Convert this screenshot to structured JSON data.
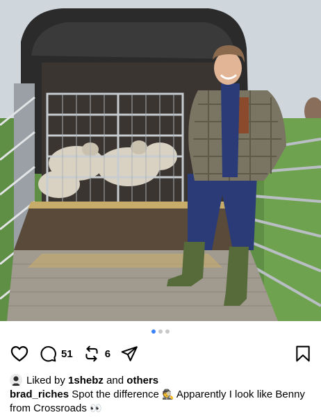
{
  "post": {
    "image_alt": "Man standing beside a livestock trailer with sheep inside",
    "carousel": {
      "count": 3,
      "active_index": 0
    }
  },
  "actions": {
    "comments_count": "51",
    "reposts_count": "6"
  },
  "likes": {
    "prefix": "Liked by",
    "user": "1shebz",
    "connector": "and",
    "others": "others"
  },
  "caption": {
    "username": "brad_riches",
    "text_1": "Spot the difference",
    "emoji_1": "🕵",
    "text_2": "Apparently I look like Benny from Crossroads",
    "emoji_2": "👀"
  },
  "icons": {
    "like": "heart-icon",
    "comment": "comment-icon",
    "repost": "repost-icon",
    "share": "send-icon",
    "save": "bookmark-icon"
  },
  "colors": {
    "active_dot": "#3b82f6",
    "inactive_dot": "#c7c7c7"
  }
}
